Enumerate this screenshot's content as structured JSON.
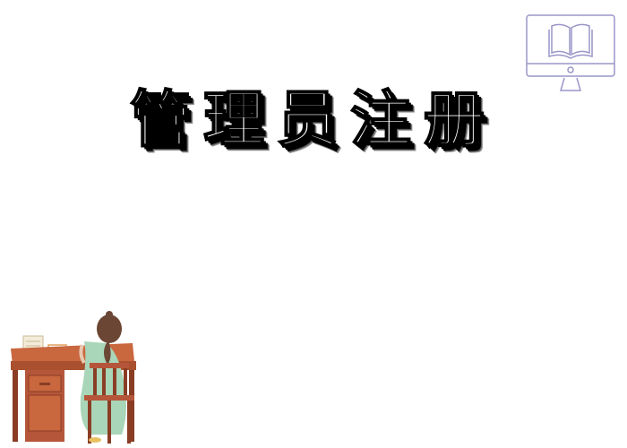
{
  "page": {
    "title": "管理员注册"
  },
  "icons": {
    "top_right": "monitor-book-icon",
    "bottom_left": "person-at-desk-illustration"
  },
  "colors": {
    "background": "#ffffff",
    "title_fill": "#ffffff",
    "title_outline": "#000000",
    "icon_stroke": "#9a96c8",
    "desk": "#b5563a",
    "hair": "#6b4634",
    "dress": "#a9d5b8"
  }
}
